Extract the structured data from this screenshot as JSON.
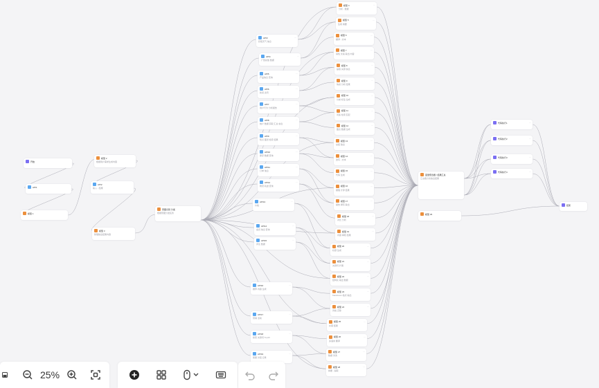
{
  "toolbar": {
    "zoom_label": "25%"
  },
  "nodes": {
    "n_start": {
      "title": "开始",
      "sub": ""
    },
    "n_api_a": {
      "title": "API1",
      "sub": ""
    },
    "n_llm_a": {
      "title": "模型 1",
      "sub": ""
    },
    "n_llm_b": {
      "title": "模型 2",
      "sub": "根据用户需求生成内容"
    },
    "n_api_b": {
      "title": "API2",
      "sub": "输入 - 结果"
    },
    "n_llm_c": {
      "title": "模型 3",
      "sub": "整理输出结果内容"
    },
    "n_hub": {
      "title": "意图识别 分发",
      "sub": "根据意图分发任务"
    },
    "mid": [
      {
        "title": "API3",
        "sub": "获取天气 信息"
      },
      {
        "title": "API4",
        "sub": "广告投放 数据"
      },
      {
        "title": "API5",
        "sub": "产品信息 查询"
      },
      {
        "title": "API6",
        "sub": "新闻 资讯"
      },
      {
        "title": "API7",
        "sub": "用户行为 分析报告"
      },
      {
        "title": "API8",
        "sub": "统计 数据 获取 汇总 信息"
      },
      {
        "title": "API9",
        "sub": "知识 图谱 检索 结果"
      },
      {
        "title": "API10",
        "sub": "库存 数据 查询"
      },
      {
        "title": "API11",
        "sub": "订单 信息"
      },
      {
        "title": "API12",
        "sub": "物流 轨迹 查询"
      },
      {
        "title": "API13",
        "sub": "价格"
      },
      {
        "title": "API14",
        "sub": "会员 信息 查询"
      },
      {
        "title": "API15",
        "sub": "评论 数据"
      },
      {
        "title": "API16",
        "sub": "推荐 内容 生成"
      },
      {
        "title": "API17",
        "sub": "营销 活动"
      },
      {
        "title": "API18",
        "sub": "搜索 关键词 Top10"
      },
      {
        "title": "API19",
        "sub": "客服 对话 记录"
      }
    ],
    "right": [
      {
        "title": "模型 4",
        "sub": "分析 - 数据"
      },
      {
        "title": "模型 5",
        "sub": "生成 摘要"
      },
      {
        "title": "模型 6",
        "sub": "翻译 - 文本"
      },
      {
        "title": "模型 7",
        "sub": "润色 文案 输出 内容"
      },
      {
        "title": "模型 8",
        "sub": "提取 关键 信息"
      },
      {
        "title": "模型 9",
        "sub": "情感 分析 结果"
      },
      {
        "title": "模型 10",
        "sub": "分类 标签 生成"
      },
      {
        "title": "模型 11",
        "sub": "问答 检索 匹配"
      },
      {
        "title": "模型 12",
        "sub": "图表 数据 生成"
      },
      {
        "title": "模型 13",
        "sub": "总结 输出"
      },
      {
        "title": "模型 14",
        "sub": "改写 - 文本"
      },
      {
        "title": "模型 15",
        "sub": "代码 生成"
      },
      {
        "title": "模型 16",
        "sub": "推理 计算 结果"
      },
      {
        "title": "模型 17",
        "sub": "报告 撰写 输出"
      },
      {
        "title": "模型 18",
        "sub": "对比 分析"
      },
      {
        "title": "模型 19",
        "sub": "内容 审核 结果"
      },
      {
        "title": "模型 20",
        "sub": "标题 生成"
      },
      {
        "title": "模型 21",
        "sub": "关键词 扩展"
      },
      {
        "title": "模型 22",
        "sub": "结构化 输出 数据"
      },
      {
        "title": "模型 23",
        "sub": "Markdown 格式 输出"
      },
      {
        "title": "模型 24",
        "sub": "风格 迁移"
      },
      {
        "title": "模型 25",
        "sub": "纠错 结果"
      },
      {
        "title": "模型 26",
        "sub": "多语言 翻译"
      },
      {
        "title": "模型 27",
        "sub": "数据 清洗"
      },
      {
        "title": "模型 28",
        "sub": "摘要 - 提取"
      }
    ],
    "n_agg": {
      "title": "变量聚合器 / 结果汇总",
      "sub": "汇总各分支输出结果"
    },
    "n_llm_end": {
      "title": "模型 29",
      "sub": ""
    },
    "far": [
      {
        "title": "代码执行1",
        "sub": ""
      },
      {
        "title": "代码执行2",
        "sub": ""
      },
      {
        "title": "代码执行3",
        "sub": ""
      },
      {
        "title": "代码执行4",
        "sub": ""
      }
    ],
    "n_end": {
      "title": "结束",
      "sub": ""
    }
  }
}
